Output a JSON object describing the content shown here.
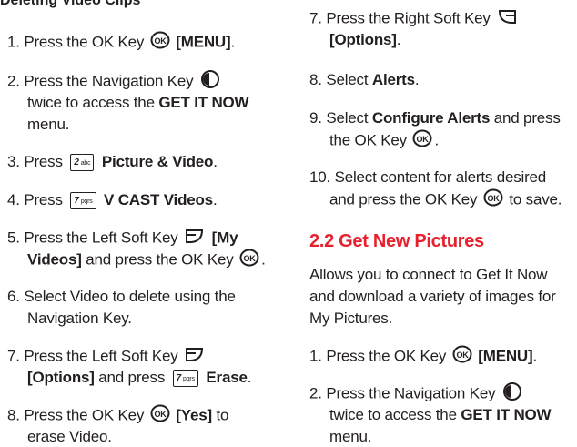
{
  "left": {
    "heading": "Deleting Video Clips",
    "steps": [
      {
        "num": "1.",
        "pre": "Press the OK Key",
        "icon": "ok-key-icon",
        "bold": "[MENU]",
        "post": "."
      },
      {
        "num": "2.",
        "pre": "Press the Navigation Key",
        "icon": "navigation-key-icon",
        "line2_pre": "twice to access the ",
        "line2_bold": "GET IT NOW",
        "line3": "menu."
      },
      {
        "num": "3.",
        "pre": "Press",
        "key_label": "2",
        "key_sub": "abc",
        "bold": "Picture & Video",
        "post": "."
      },
      {
        "num": "4.",
        "pre": "Press",
        "key_label": "7",
        "key_sub": "pqrs",
        "bold": "V CAST Videos",
        "post": "."
      },
      {
        "num": "5.",
        "pre": "Press the Left Soft Key",
        "bold": "[My",
        "line2_bold": "Videos]",
        "line2_post": " and press the OK Key"
      },
      {
        "num": "6.",
        "pre": "Select Video to delete using the",
        "line2": "Navigation Key."
      },
      {
        "num": "7.",
        "pre": "Press the Left Soft Key",
        "line2_bold": "[Options]",
        "line2_mid": " and press",
        "key_label": "7",
        "key_sub": "pqrs",
        "line2_bold2": "Erase",
        "post": "."
      },
      {
        "num": "8.",
        "pre": "Press the OK Key",
        "bold": "[Yes]",
        "post": " to",
        "line2": "erase Video."
      }
    ]
  },
  "right": {
    "steps_top": [
      {
        "num": "7.",
        "pre": "Press the Right Soft Key",
        "line2_bold": "[Options]",
        "post": "."
      },
      {
        "num": "8.",
        "pre": "Select ",
        "bold": "Alerts",
        "post": "."
      },
      {
        "num": "9.",
        "pre": "Select ",
        "bold": "Configure Alerts",
        "post": " and press",
        "line2": "the OK Key",
        "line2_post": "."
      },
      {
        "num": "10.",
        "pre": "Select content for alerts desired",
        "line2": "and press the OK Key",
        "line2_post": " to save."
      }
    ],
    "section_title": "2.2 Get New Pictures",
    "section_para": [
      "Allows you to connect to Get It Now",
      "and download a variety of images for",
      "My Pictures."
    ],
    "steps_bottom": [
      {
        "num": "1.",
        "pre": "Press the OK Key",
        "bold": "[MENU]",
        "post": "."
      },
      {
        "num": "2.",
        "pre": "Press the Navigation Key",
        "line2_pre": "twice to access the ",
        "line2_bold": "GET IT NOW",
        "line3": "menu."
      }
    ]
  }
}
